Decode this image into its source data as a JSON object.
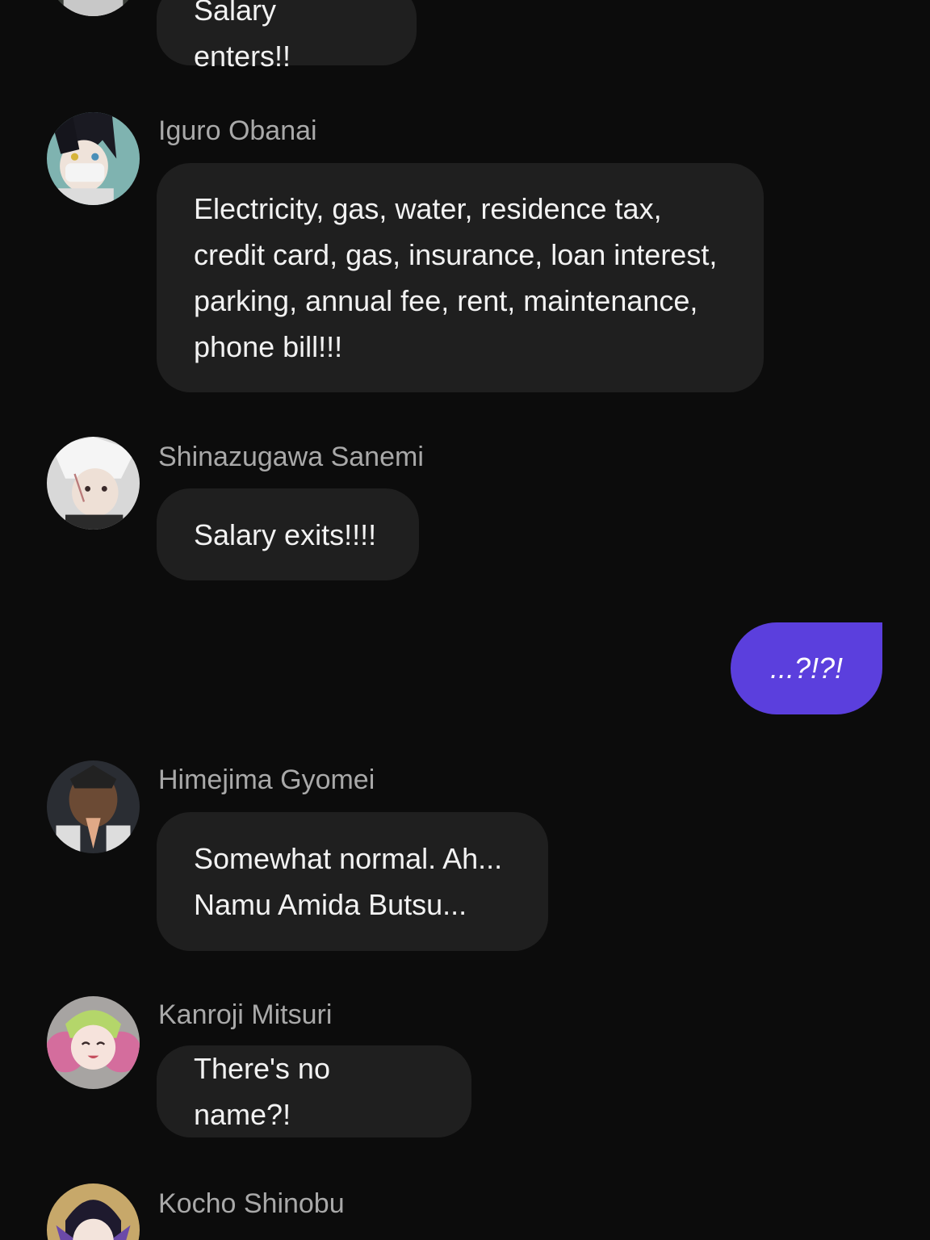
{
  "messages": [
    {
      "text": "Salary enters!!"
    },
    {
      "sender": "Iguro Obanai",
      "lines": [
        "Electricity, gas, water, residence tax,",
        "credit card, gas, insurance, loan interest,",
        "parking, annual fee, rent, maintenance,",
        "phone bill!!!"
      ]
    },
    {
      "sender": "Shinazugawa Sanemi",
      "text": "Salary exits!!!!"
    },
    {
      "outgoing": true,
      "text": "...?!?!"
    },
    {
      "sender": "Himejima Gyomei",
      "lines": [
        "Somewhat normal. Ah...",
        "Namu Amida Butsu..."
      ]
    },
    {
      "sender": "Kanroji Mitsuri",
      "text": "There's no name?!"
    },
    {
      "sender": "Kocho Shinobu"
    }
  ],
  "colors": {
    "background": "#0c0c0c",
    "incoming_bubble": "#1f1f1f",
    "outgoing_bubble": "#5b3fdd",
    "sender_name": "#a9a9a9",
    "message_text": "#f2f2f2"
  },
  "avatars": [
    "avatar-partial-top",
    "avatar-iguro-obanai",
    "avatar-shinazugawa-sanemi",
    "avatar-himejima-gyomei",
    "avatar-kanroji-mitsuri",
    "avatar-kocho-shinobu"
  ]
}
